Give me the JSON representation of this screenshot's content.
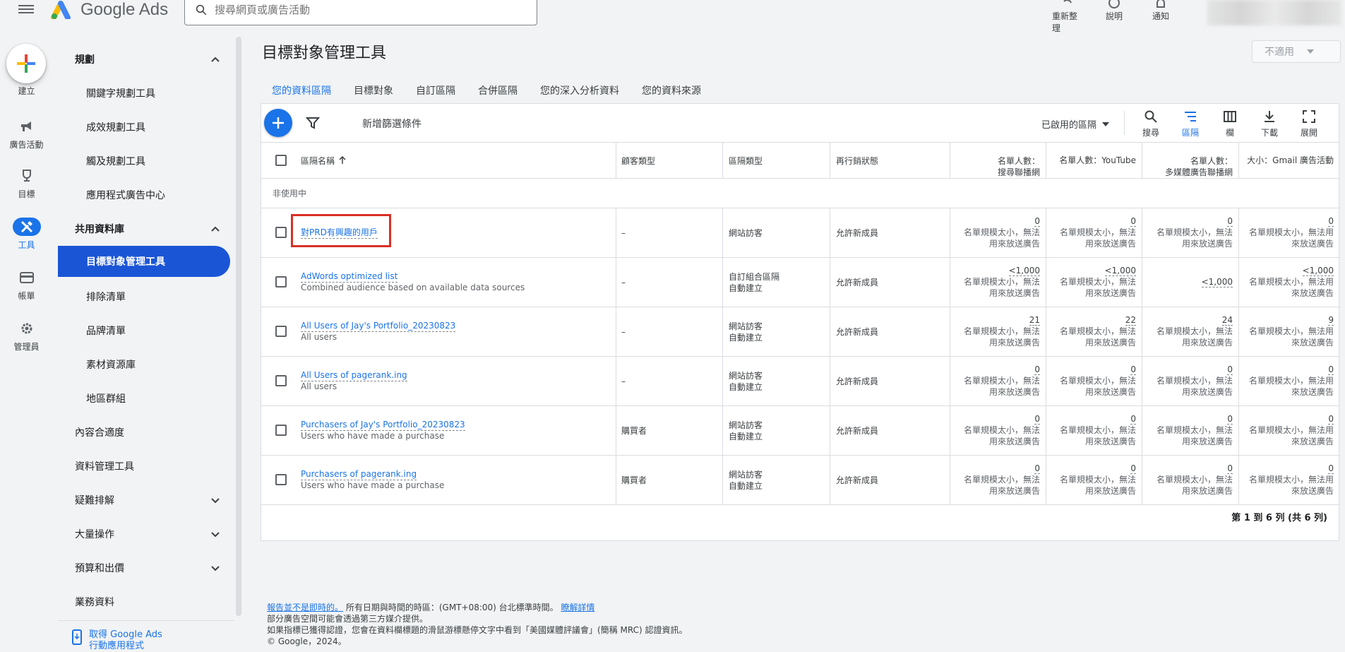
{
  "app": {
    "name": "Google Ads"
  },
  "search": {
    "placeholder": "搜尋網頁或廣告活動"
  },
  "top_actions": [
    {
      "label": "重新整理",
      "icon": "refresh-icon"
    },
    {
      "label": "說明",
      "icon": "help-icon"
    },
    {
      "label": "通知",
      "icon": "bell-icon"
    }
  ],
  "rail": {
    "create": "建立",
    "items": [
      {
        "label": "廣告活動",
        "icon": "megaphone-icon"
      },
      {
        "label": "目標",
        "icon": "trophy-icon"
      },
      {
        "label": "工具",
        "icon": "tools-icon"
      },
      {
        "label": "帳單",
        "icon": "credit-card-icon"
      },
      {
        "label": "管理員",
        "icon": "gear-icon"
      }
    ]
  },
  "sidenav": {
    "items": [
      {
        "label": "規劃",
        "type": "group",
        "expanded": true
      },
      {
        "label": "關鍵字規劃工具",
        "type": "sub"
      },
      {
        "label": "成效規劃工具",
        "type": "sub"
      },
      {
        "label": "觸及規劃工具",
        "type": "sub"
      },
      {
        "label": "應用程式廣告中心",
        "type": "sub"
      },
      {
        "label": "共用資料庫",
        "type": "group",
        "expanded": true
      },
      {
        "label": "目標對象管理工具",
        "type": "sub",
        "active": true
      },
      {
        "label": "排除清單",
        "type": "sub"
      },
      {
        "label": "品牌清單",
        "type": "sub"
      },
      {
        "label": "素材資源庫",
        "type": "sub"
      },
      {
        "label": "地區群組",
        "type": "sub"
      },
      {
        "label": "內容合適度",
        "type": "group"
      },
      {
        "label": "資料管理工具",
        "type": "group"
      },
      {
        "label": "疑難排解",
        "type": "group",
        "collapsed": true
      },
      {
        "label": "大量操作",
        "type": "group",
        "collapsed": true
      },
      {
        "label": "預算和出價",
        "type": "group",
        "collapsed": true
      },
      {
        "label": "業務資料",
        "type": "group"
      }
    ],
    "get_app_line1": "取得 Google Ads",
    "get_app_line2": "行動應用程式"
  },
  "page": {
    "title": "目標對象管理工具",
    "na_select": "不適用"
  },
  "tabs": [
    {
      "label": "您的資料區隔",
      "active": true
    },
    {
      "label": "目標對象"
    },
    {
      "label": "自訂區隔"
    },
    {
      "label": "合併區隔"
    },
    {
      "label": "您的深入分析資料"
    },
    {
      "label": "您的資料來源"
    }
  ],
  "toolbar": {
    "add_filter": "新增篩選條件",
    "segment_dropdown": "已啟用的區隔",
    "buttons": [
      {
        "label": "搜尋",
        "icon": "search-icon"
      },
      {
        "label": "區隔",
        "icon": "segment-icon",
        "active": true
      },
      {
        "label": "欄",
        "icon": "columns-icon"
      },
      {
        "label": "下載",
        "icon": "download-icon"
      },
      {
        "label": "展開",
        "icon": "fullscreen-icon"
      }
    ]
  },
  "table": {
    "headers": {
      "name": "區隔名稱",
      "customer_type": "顧客類型",
      "segment_type": "區隔類型",
      "remarketing": "再行銷狀態",
      "size_search_1": "名單人數：",
      "size_search_2": "搜尋聯播網",
      "size_youtube": "名單人數：YouTube",
      "size_display_1": "名單人數：",
      "size_display_2": "多媒體廣告聯播網",
      "size_gmail": "大小：Gmail 廣告活動"
    },
    "group_label": "非使用中",
    "note_a": "名單規模太小，無法",
    "note_b": "用來放送廣告",
    "note_b_gmail": "來放送廣告",
    "note_a_gmail": "名單規模太小，無法用",
    "rows": [
      {
        "name": "對PRD有興趣的用戶",
        "sub": "",
        "customer": "–",
        "type1": "網站訪客",
        "type2": "",
        "remarketing": "允許新成員",
        "search": "0",
        "youtube": "0",
        "display": "0",
        "gmail": "0",
        "display_note": true
      },
      {
        "name": "AdWords optimized list",
        "sub": "Combined audience based on available data sources",
        "customer": "–",
        "type1": "自訂組合區隔",
        "type2": "自動建立",
        "remarketing": "允許新成員",
        "search": "<1,000",
        "youtube": "<1,000",
        "display": "<1,000",
        "gmail": "<1,000",
        "display_note": false
      },
      {
        "name": "All Users of Jay's Portfolio_20230823",
        "sub": "All users",
        "customer": "–",
        "type1": "網站訪客",
        "type2": "自動建立",
        "remarketing": "允許新成員",
        "search": "21",
        "youtube": "22",
        "display": "24",
        "gmail": "9",
        "display_note": true
      },
      {
        "name": "All Users of pagerank.ing",
        "sub": "All users",
        "customer": "–",
        "type1": "網站訪客",
        "type2": "自動建立",
        "remarketing": "允許新成員",
        "search": "0",
        "youtube": "0",
        "display": "0",
        "gmail": "0",
        "display_note": true
      },
      {
        "name": "Purchasers of Jay's Portfolio_20230823",
        "sub": "Users who have made a purchase",
        "customer": "購買者",
        "type1": "網站訪客",
        "type2": "自動建立",
        "remarketing": "允許新成員",
        "search": "0",
        "youtube": "0",
        "display": "0",
        "gmail": "0",
        "display_note": true
      },
      {
        "name": "Purchasers of pagerank.ing",
        "sub": "Users who have made a purchase",
        "customer": "購買者",
        "type1": "網站訪客",
        "type2": "自動建立",
        "remarketing": "允許新成員",
        "search": "0",
        "youtube": "0",
        "display": "0",
        "gmail": "0",
        "display_note": true
      }
    ],
    "pagination": "第 1 到 6 列 (共 6 列)"
  },
  "footer": {
    "link1": "報告並不是即時的。",
    "text1": "所有日期與時間的時區：(GMT+08:00) 台北標準時間。",
    "link2": "瞭解詳情",
    "line2": "部分廣告空間可能會透過第三方媒介提供。",
    "line3": "如果指標已獲得認證，您會在資料欄標題的滑鼠游標懸停文字中看到「美國媒體評議會」(簡稱 MRC) 認證資訊。",
    "line4": "© Google，2024。"
  },
  "colors": {
    "accent": "#1a73e8",
    "active_nav": "#1a55d6",
    "highlight": "#d93025"
  }
}
